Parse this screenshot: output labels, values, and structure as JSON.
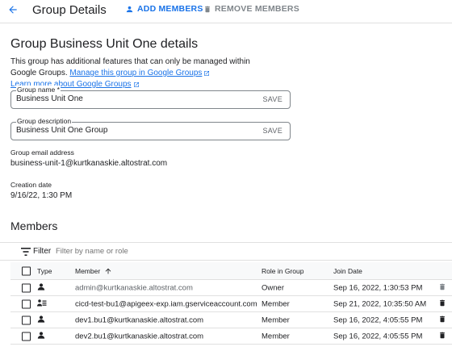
{
  "header": {
    "title": "Group Details",
    "add_members": "ADD MEMBERS",
    "remove_members": "REMOVE MEMBERS"
  },
  "details": {
    "title": "Group Business Unit One details",
    "info_text": "This group has additional features that can only be managed within Google Groups.",
    "manage_link": "Manage this group in Google Groups",
    "learn_link": "Learn more about Google Groups"
  },
  "form": {
    "name_label": "Group name *",
    "name_value": "Business Unit One",
    "desc_label": "Group description",
    "desc_value": "Business Unit One Group",
    "save_label": "SAVE"
  },
  "meta": {
    "email_label": "Group email address",
    "email_value": "business-unit-1@kurtkanaskie.altostrat.com",
    "created_label": "Creation date",
    "created_value": "9/16/22, 1:30 PM"
  },
  "members": {
    "title": "Members",
    "filter_label": "Filter",
    "filter_placeholder": "Filter by name or role",
    "columns": {
      "type": "Type",
      "member": "Member",
      "role": "Role in Group",
      "join": "Join Date"
    },
    "rows": [
      {
        "type_icon": "person-icon",
        "member": "admin@kurtkanaskie.altostrat.com",
        "role": "Owner",
        "join": "Sep 16, 2022, 1:30:53 PM",
        "muted": true
      },
      {
        "type_icon": "service-account-icon",
        "member": "cicd-test-bu1@apigeex-exp.iam.gserviceaccount.com",
        "role": "Member",
        "join": "Sep 21, 2022, 10:35:50 AM",
        "muted": false
      },
      {
        "type_icon": "person-icon",
        "member": "dev1.bu1@kurtkanaskie.altostrat.com",
        "role": "Member",
        "join": "Sep 16, 2022, 4:05:55 PM",
        "muted": false
      },
      {
        "type_icon": "person-icon",
        "member": "dev2.bu1@kurtkanaskie.altostrat.com",
        "role": "Member",
        "join": "Sep 16, 2022, 4:05:55 PM",
        "muted": false
      }
    ]
  },
  "colors": {
    "accent": "#1a73e8",
    "disabled": "#80868b",
    "text": "#202124",
    "muted_text": "#5f6368"
  }
}
